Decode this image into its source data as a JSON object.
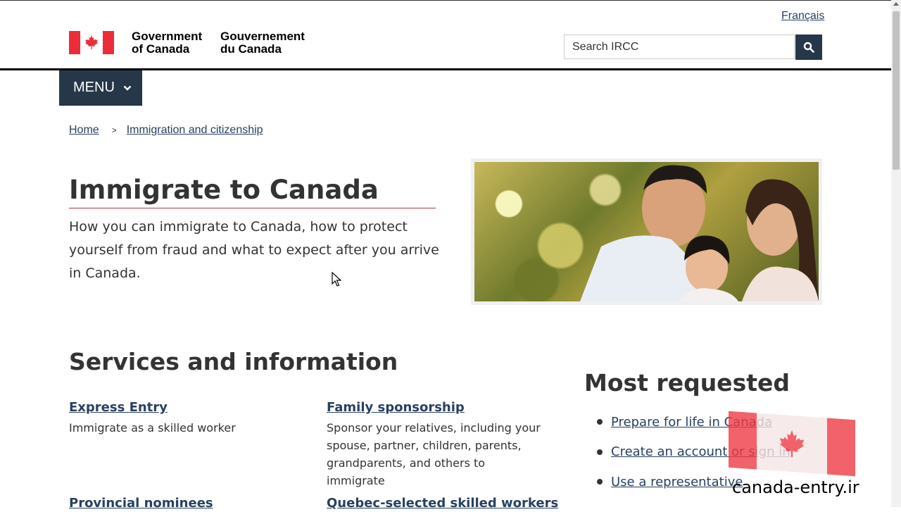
{
  "header": {
    "language_link": "Français",
    "wordmark_en": "Government\nof Canada",
    "wordmark_fr": "Gouvernement\ndu Canada",
    "search_placeholder": "Search IRCC",
    "search_icon": "search-icon"
  },
  "nav": {
    "menu_label": "MENU",
    "menu_icon": "chevron-down-icon"
  },
  "breadcrumb": {
    "items": [
      "Home",
      "Immigration and citizenship"
    ],
    "separator": ">"
  },
  "main": {
    "title": "Immigrate to Canada",
    "intro": "How you can immigrate to Canada, how to protect yourself from fraud and what to expect after you arrive in Canada.",
    "section_title": "Services and information",
    "services": [
      {
        "title": "Express Entry",
        "desc": "Immigrate as a skilled worker"
      },
      {
        "title": "Family sponsorship",
        "desc": "Sponsor your relatives, including your spouse, partner, children, parents, grandparents, and others to immigrate"
      },
      {
        "title": "Provincial nominees",
        "desc": ""
      },
      {
        "title": "Quebec-selected skilled workers",
        "desc": ""
      }
    ]
  },
  "most_requested": {
    "title": "Most requested",
    "items": [
      "Prepare for life in Canada",
      "Create an account or sign in",
      "Use a representative"
    ]
  },
  "watermark": {
    "text": "canada-entry.ir"
  },
  "colors": {
    "nav_dark": "#26374a",
    "link": "#284162",
    "flag_red": "#eb2d37",
    "title_rule": "#af3c43"
  }
}
